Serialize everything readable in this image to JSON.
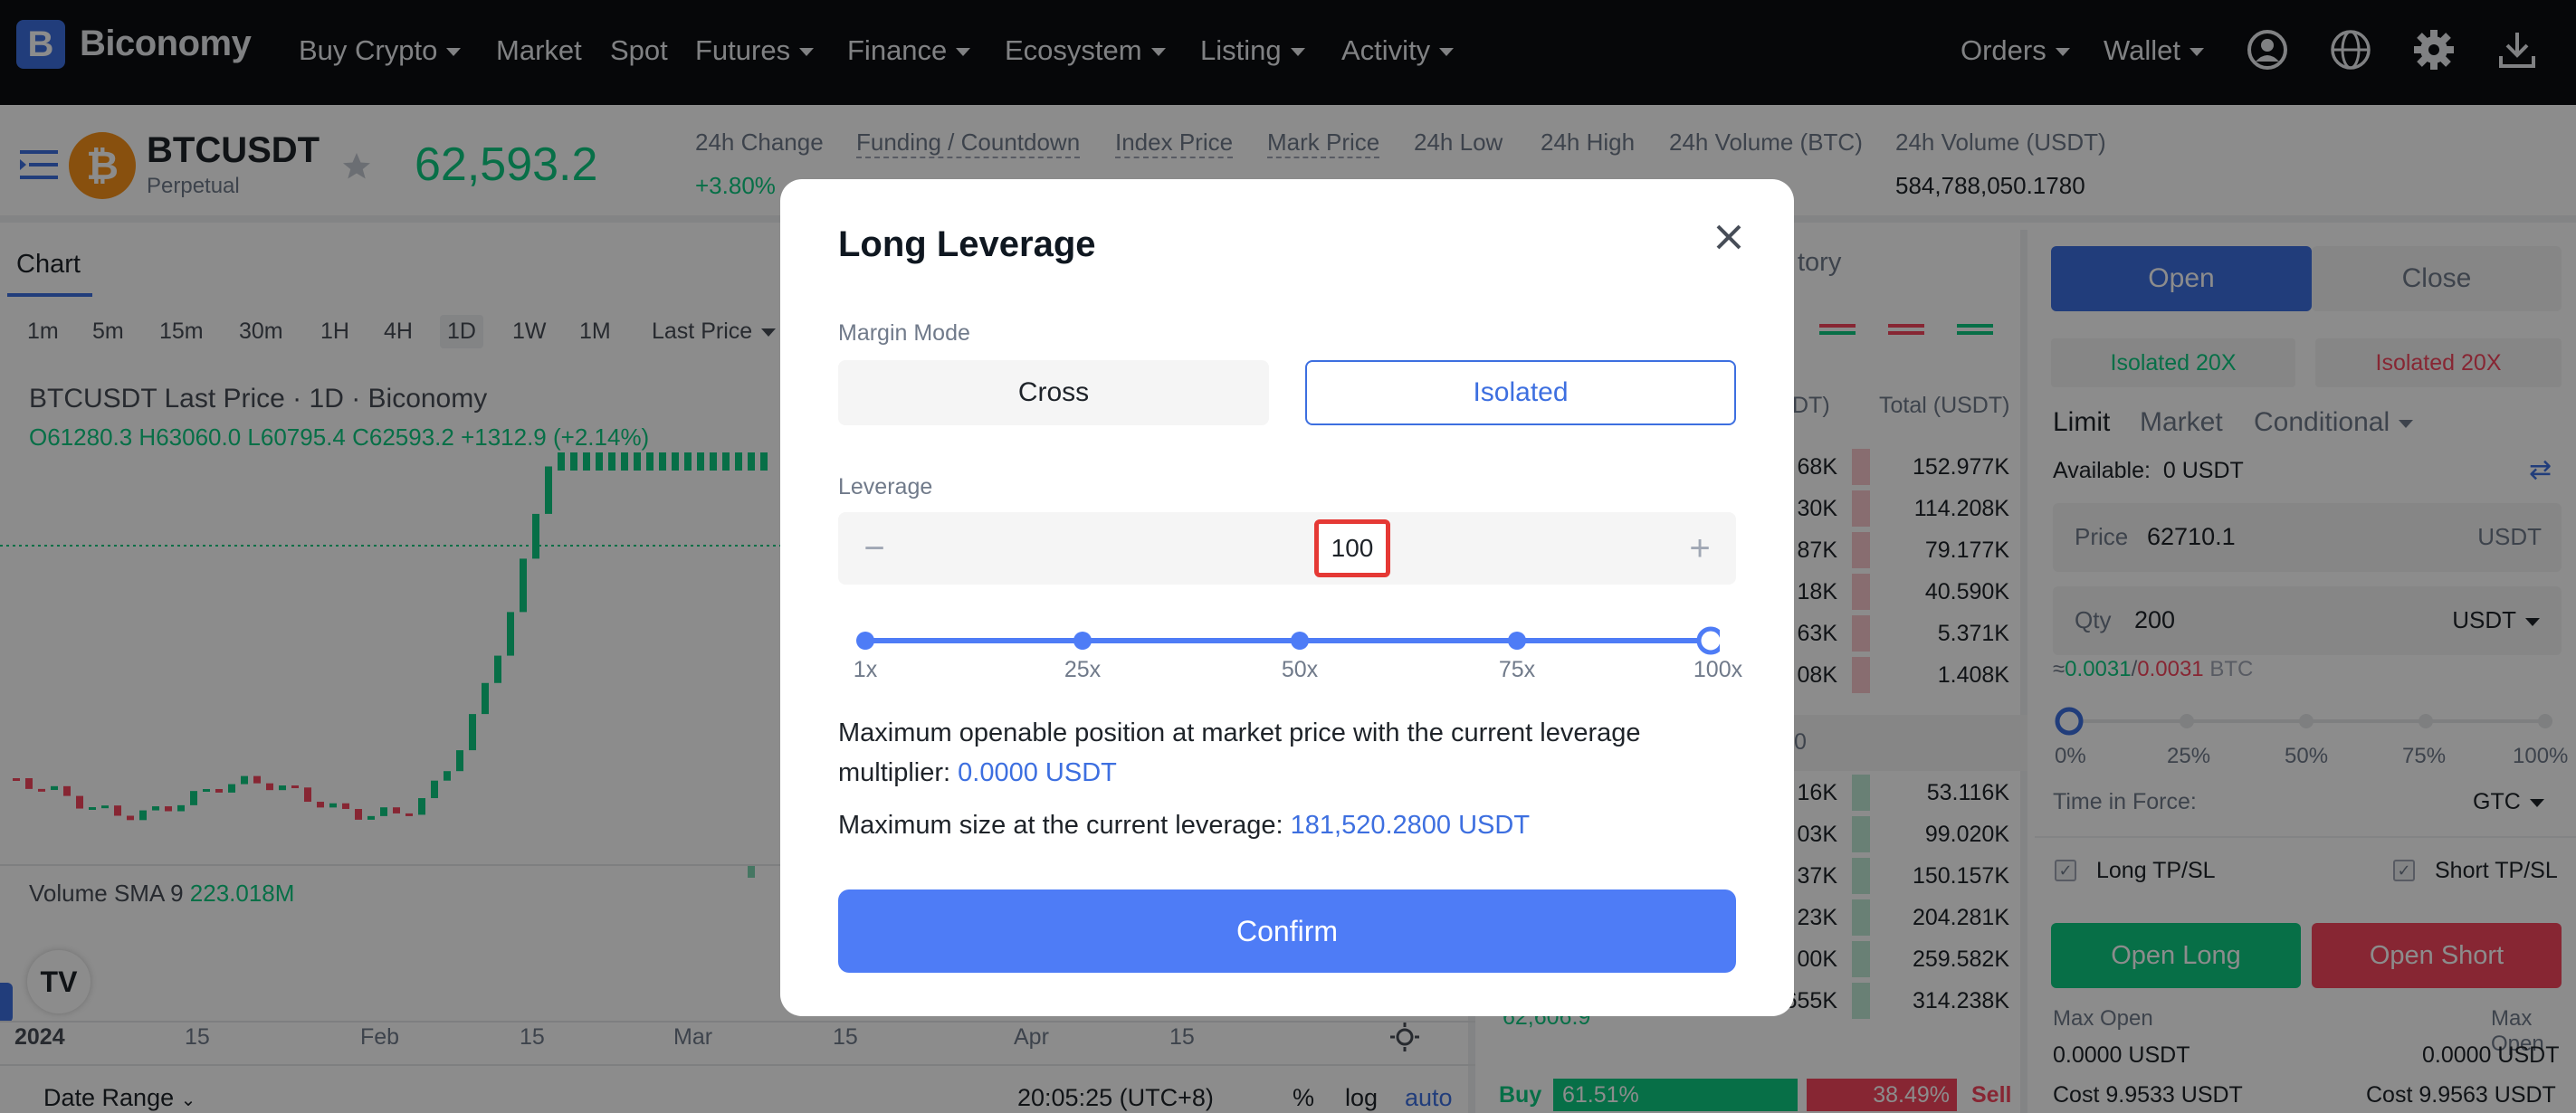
{
  "brand": {
    "logo_letter": "B",
    "name": "Biconomy",
    "accent": "#3d6fe0"
  },
  "nav": {
    "items": [
      {
        "label": "Buy Crypto",
        "has_caret": true
      },
      {
        "label": "Market",
        "has_caret": false
      },
      {
        "label": "Spot",
        "has_caret": false
      },
      {
        "label": "Futures",
        "has_caret": true
      },
      {
        "label": "Finance",
        "has_caret": true
      },
      {
        "label": "Ecosystem",
        "has_caret": true
      },
      {
        "label": "Listing",
        "has_caret": true
      },
      {
        "label": "Activity",
        "has_caret": true
      }
    ],
    "right": {
      "orders": "Orders",
      "wallet": "Wallet"
    },
    "icons": [
      "user-icon",
      "globe-icon",
      "gear-icon",
      "download-icon"
    ]
  },
  "ticker": {
    "symbol": "BTCUSDT",
    "contract": "Perpetual",
    "last_price": "62,593.2",
    "stats": [
      {
        "label": "24h Change",
        "value": "+3.80%"
      },
      {
        "label": "Funding / Countdown",
        "value": ""
      },
      {
        "label": "Index Price",
        "value": ""
      },
      {
        "label": "Mark Price",
        "value": ""
      },
      {
        "label": "24h Low",
        "value": ""
      },
      {
        "label": "24h High",
        "value": ""
      },
      {
        "label": "24h Volume (BTC)",
        "value": ""
      },
      {
        "label": "24h Volume (USDT)",
        "value": "584,788,050.1780"
      }
    ]
  },
  "chart": {
    "tab": "Chart",
    "timeframes": [
      "1m",
      "5m",
      "15m",
      "30m",
      "1H",
      "4H",
      "1D",
      "1W",
      "1M"
    ],
    "active_timeframe": "1D",
    "price_type": "Last Price",
    "legend_title": "BTCUSDT Last Price · 1D · Biconomy",
    "ohlc": "O61280.3 H63060.0 L60795.4 C62593.2 +1312.9 (+2.14%)",
    "volume_label": "Volume SMA 9",
    "volume_value": "223.018M",
    "x_labels": [
      "2024",
      "15",
      "Feb",
      "15",
      "Mar",
      "15",
      "Apr",
      "15"
    ],
    "date_range": "Date Range",
    "clock": "20:05:25 (UTC+8)",
    "scale_pct": "%",
    "scale_log": "log",
    "scale_auto": "auto"
  },
  "orderbook": {
    "tab_partial": "tory",
    "header_mid": "DT)",
    "header_total": "Total (USDT)",
    "asks": [
      {
        "amount": "68K",
        "total": "152.977K"
      },
      {
        "amount": "30K",
        "total": "114.208K"
      },
      {
        "amount": "87K",
        "total": "79.177K"
      },
      {
        "amount": "18K",
        "total": "40.590K"
      },
      {
        "amount": "63K",
        "total": "5.371K"
      },
      {
        "amount": "08K",
        "total": "1.408K"
      }
    ],
    "mid": "0",
    "bids": [
      {
        "amount": "16K",
        "total": "53.116K"
      },
      {
        "amount": "03K",
        "total": "99.020K"
      },
      {
        "amount": "37K",
        "total": "150.157K"
      },
      {
        "amount": "23K",
        "total": "204.281K"
      },
      {
        "amount": "00K",
        "total": "259.582K"
      },
      {
        "amount": "54.655K",
        "total": "314.238K"
      }
    ],
    "last_bid_price": "62,606.9",
    "buy_label": "Buy",
    "buy_pct": "61.51%",
    "sell_pct": "38.49%",
    "sell_label": "Sell"
  },
  "order_panel": {
    "open": "Open",
    "close": "Close",
    "iso_long": "Isolated 20X",
    "iso_short": "Isolated 20X",
    "types": [
      "Limit",
      "Market",
      "Conditional"
    ],
    "available_label": "Available:",
    "available_value": "0 USDT",
    "price_label": "Price",
    "price_value": "62710.1",
    "price_unit": "USDT",
    "qty_label": "Qty",
    "qty_value": "200",
    "qty_unit": "USDT",
    "approx_prefix": "≈",
    "approx_long": "0.0031",
    "approx_short": "0.0031",
    "approx_unit": "BTC",
    "pct_labels": [
      "0%",
      "25%",
      "50%",
      "75%",
      "100%"
    ],
    "tif_label": "Time in Force:",
    "tif_value": "GTC",
    "long_tpsl": "Long TP/SL",
    "short_tpsl": "Short TP/SL",
    "open_long": "Open Long",
    "open_short": "Open Short",
    "max_open_label": "Max Open",
    "max_open_long": "0.0000 USDT",
    "max_open_short": "0.0000 USDT",
    "cost_long": "Cost 9.9533 USDT",
    "cost_short": "Cost 9.9563 USDT"
  },
  "modal": {
    "title": "Long Leverage",
    "margin_mode_label": "Margin Mode",
    "cross": "Cross",
    "isolated": "Isolated",
    "selected_mode": "Isolated",
    "leverage_label": "Leverage",
    "minus": "−",
    "plus": "+",
    "leverage_value": "100",
    "slider_ticks": [
      "1x",
      "25x",
      "50x",
      "75x",
      "100x"
    ],
    "slider_fraction": 1.0,
    "max_openable_text": "Maximum openable position at market price with the current leverage multiplier:",
    "max_openable_value": "0.0000 USDT",
    "max_size_text": "Maximum size at the current leverage:",
    "max_size_value": "181,520.2800 USDT",
    "confirm": "Confirm"
  },
  "colors": {
    "green": "#0ecb81",
    "red": "#f6465d",
    "primary": "#4e7cf6"
  }
}
